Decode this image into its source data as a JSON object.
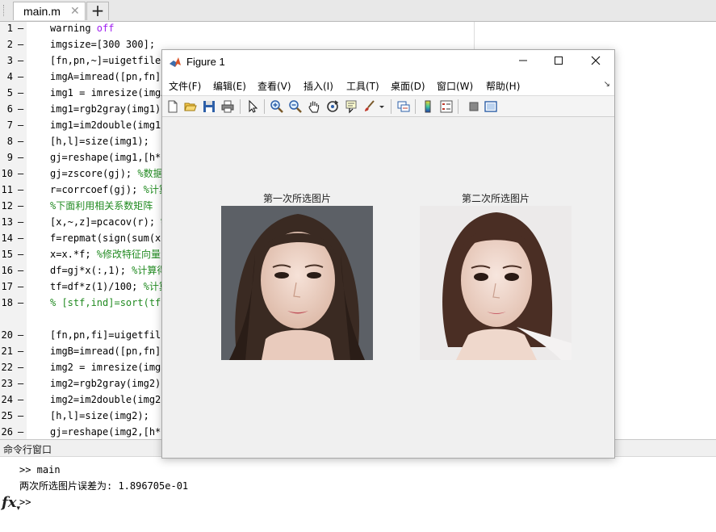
{
  "editor": {
    "tab_label": "main.m",
    "tab_close": "✕",
    "tab_add": "+",
    "lines": [
      {
        "n": "1",
        "code": "warning ",
        "kw": "off",
        "cm": ""
      },
      {
        "n": "2",
        "code": "imgsize=[300 300];",
        "kw": "",
        "cm": ""
      },
      {
        "n": "3",
        "code": "[fn,pn,~]=uigetfile(",
        "kw": "",
        "cm": ""
      },
      {
        "n": "4",
        "code": "imgA=imread([pn,fn])",
        "kw": "",
        "cm": ""
      },
      {
        "n": "5",
        "code": "img1 = imresize(imgA",
        "kw": "",
        "cm": ""
      },
      {
        "n": "6",
        "code": "img1=rgb2gray(img1);",
        "kw": "",
        "cm": ""
      },
      {
        "n": "7",
        "code": "img1=im2double(img1)",
        "kw": "",
        "cm": ""
      },
      {
        "n": "8",
        "code": "[h,l]=size(img1);",
        "kw": "",
        "cm": ""
      },
      {
        "n": "9",
        "code": "gj=reshape(img1,[h*l",
        "kw": "",
        "cm": ""
      },
      {
        "n": "10",
        "code": "gj=zscore(gj); ",
        "kw": "",
        "cm": "%数据"
      },
      {
        "n": "11",
        "code": "r=corrcoef(gj); ",
        "kw": "",
        "cm": "%计算"
      },
      {
        "n": "12",
        "code": "",
        "kw": "",
        "cm": "%下面利用相关系数矩阵"
      },
      {
        "n": "13",
        "code": "[x,~,z]=pcacov(r); ",
        "kw": "",
        "cm": "%"
      },
      {
        "n": "14",
        "code": "f=repmat(sign(sum(x)",
        "kw": "",
        "cm": ""
      },
      {
        "n": "15",
        "code": "x=x.*f; ",
        "kw": "",
        "cm": "%修改特征向量"
      },
      {
        "n": "16",
        "code": "df=gj*x(:,1); ",
        "kw": "",
        "cm": "%计算得"
      },
      {
        "n": "17",
        "code": "tf=df*z(1)/100; ",
        "kw": "",
        "cm": "%计算"
      },
      {
        "n": "18",
        "code": "",
        "kw": "",
        "cm": "% [stf,ind]=sort(tf,"
      },
      {
        "n": "",
        "code": "",
        "kw": "",
        "cm": ""
      },
      {
        "n": "20",
        "code": "[fn,pn,fi]=uigetfile",
        "kw": "",
        "cm": ""
      },
      {
        "n": "21",
        "code": "imgB=imread([pn,fn])",
        "kw": "",
        "cm": ""
      },
      {
        "n": "22",
        "code": "img2 = imresize(imgB",
        "kw": "",
        "cm": ""
      },
      {
        "n": "23",
        "code": "img2=rgb2gray(img2);",
        "kw": "",
        "cm": ""
      },
      {
        "n": "24",
        "code": "img2=im2double(img2)",
        "kw": "",
        "cm": ""
      },
      {
        "n": "25",
        "code": "[h,l]=size(img2);",
        "kw": "",
        "cm": ""
      },
      {
        "n": "26",
        "code": "gj=reshape(img2,[h*l",
        "kw": "",
        "cm": ""
      }
    ]
  },
  "command_window": {
    "title": "命令行窗口",
    "lines": [
      ">> main",
      "两次所选图片误差为: 1.896705e-01"
    ],
    "prompt": ">>"
  },
  "figure": {
    "title": "Figure 1",
    "menus": [
      "文件(F)",
      "编辑(E)",
      "查看(V)",
      "插入(I)",
      "工具(T)",
      "桌面(D)",
      "窗口(W)",
      "帮助(H)"
    ],
    "axes": [
      {
        "title": "第一次所选图片"
      },
      {
        "title": "第二次所选图片"
      }
    ],
    "colors": {
      "window_bg": "#f0f0f0",
      "comment": "#228b22",
      "keyword": "#a020f0"
    }
  }
}
